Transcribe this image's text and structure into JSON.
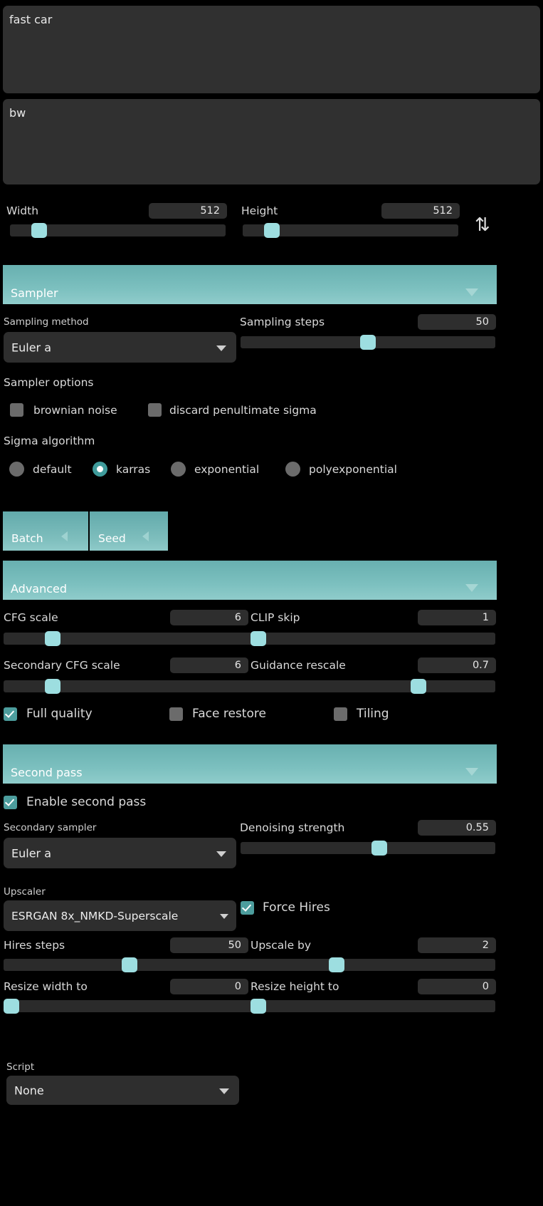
{
  "prompts": {
    "positive": "fast car",
    "negative": "bw"
  },
  "size": {
    "width_label": "Width",
    "width_value": "512",
    "height_label": "Height",
    "height_value": "512",
    "swap_icon": "swap-vertical-arrows-icon"
  },
  "sampler_section": {
    "title": "Sampler",
    "caret": "chevron-down-icon",
    "sampling_method_label": "Sampling method",
    "sampling_method_value": "Euler a",
    "sampling_steps_label": "Sampling steps",
    "sampling_steps_value": "50",
    "sampler_options_label": "Sampler options",
    "options": [
      {
        "label": "brownian noise",
        "checked": false
      },
      {
        "label": "discard penultimate sigma",
        "checked": false
      }
    ],
    "sigma_algorithm_label": "Sigma algorithm",
    "sigma_options": [
      {
        "label": "default",
        "selected": false
      },
      {
        "label": "karras",
        "selected": true
      },
      {
        "label": "exponential",
        "selected": false
      },
      {
        "label": "polyexponential",
        "selected": false
      }
    ]
  },
  "tabs": [
    {
      "label": "Batch",
      "caret": "chevron-left-icon"
    },
    {
      "label": "Seed",
      "caret": "chevron-left-icon"
    }
  ],
  "advanced_section": {
    "title": "Advanced",
    "caret": "chevron-down-icon",
    "cfg_scale_label": "CFG scale",
    "cfg_scale_value": "6",
    "clip_skip_label": "CLIP skip",
    "clip_skip_value": "1",
    "secondary_cfg_label": "Secondary CFG scale",
    "secondary_cfg_value": "6",
    "guidance_rescale_label": "Guidance rescale",
    "guidance_rescale_value": "0.7",
    "toggles": [
      {
        "label": "Full quality",
        "checked": true
      },
      {
        "label": "Face restore",
        "checked": false
      },
      {
        "label": "Tiling",
        "checked": false
      }
    ]
  },
  "second_pass_section": {
    "title": "Second pass",
    "caret": "chevron-down-icon",
    "enable_label": "Enable second pass",
    "enable_checked": true,
    "secondary_sampler_label": "Secondary sampler",
    "secondary_sampler_value": "Euler a",
    "denoising_label": "Denoising strength",
    "denoising_value": "0.55",
    "upscaler_label": "Upscaler",
    "upscaler_value": "ESRGAN 8x_NMKD-Superscale",
    "force_hires_label": "Force Hires",
    "force_hires_checked": true,
    "hires_steps_label": "Hires steps",
    "hires_steps_value": "50",
    "upscale_by_label": "Upscale by",
    "upscale_by_value": "2",
    "resize_width_label": "Resize width to",
    "resize_width_value": "0",
    "resize_height_label": "Resize height to",
    "resize_height_value": "0"
  },
  "script": {
    "label": "Script",
    "value": "None"
  },
  "colors": {
    "accent": "#7cc0bf",
    "knob": "#9ddee0",
    "field_bg": "#2e2e2e",
    "page_bg": "#000000",
    "check_on": "#4c9d9d"
  }
}
